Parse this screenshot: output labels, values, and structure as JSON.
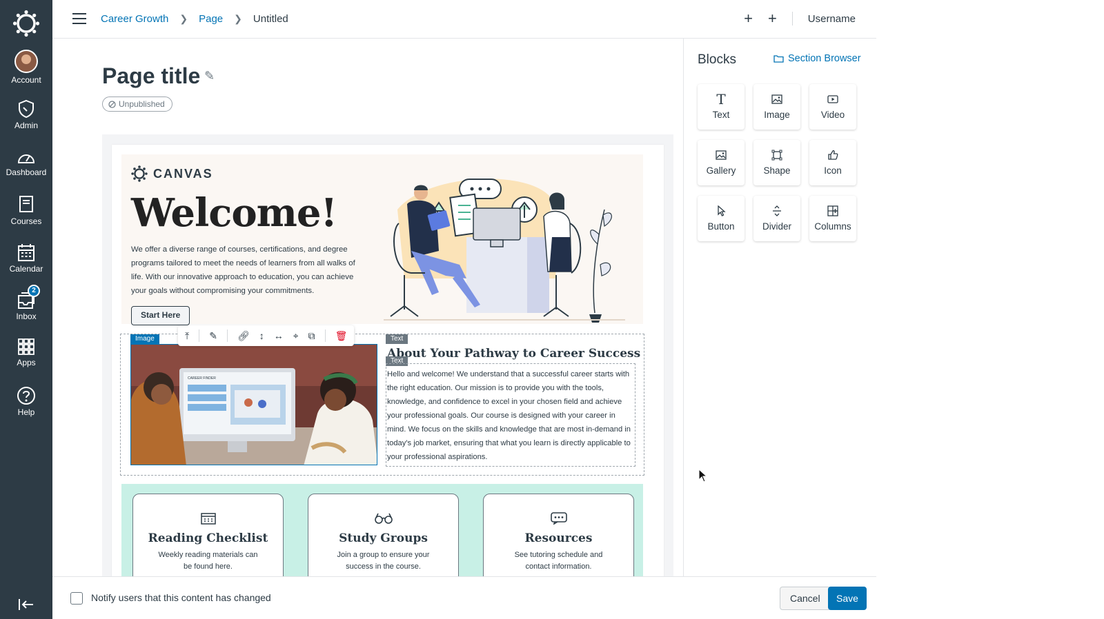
{
  "nav": {
    "items": [
      {
        "label": "Account"
      },
      {
        "label": "Admin"
      },
      {
        "label": "Dashboard"
      },
      {
        "label": "Courses"
      },
      {
        "label": "Calendar"
      },
      {
        "label": "Inbox",
        "badge": "2"
      },
      {
        "label": "Apps"
      },
      {
        "label": "Help"
      }
    ]
  },
  "topbar": {
    "breadcrumbs": [
      "Career Growth",
      "Page",
      "Untitled"
    ],
    "username": "Username"
  },
  "page": {
    "title": "Page title",
    "status": "Unpublished"
  },
  "hero": {
    "brand": "CANVAS",
    "heading": "Welcome!",
    "body": "We offer a diverse range of courses, certifications, and degree programs tailored to meet the needs of learners from all walks of life. With our innovative approach to education, you can achieve your goals without compromising your commitments.",
    "button": "Start Here"
  },
  "selection": {
    "image_tag": "Image",
    "text_tag": "Text",
    "text_tag2": "Text",
    "about_heading": "About Your Pathway to Career Success",
    "about_body": "Hello and welcome! We understand that a successful career starts with the right education. Our mission is to provide you with the tools, knowledge, and confidence to excel in your chosen field and achieve your professional goals. Our course is designed with your career in mind. We focus on the skills and knowledge that are most in-demand in today's job market, ensuring that what you learn is directly applicable to your professional aspirations.",
    "monitor_header": "CAREER FINDER"
  },
  "cards": [
    {
      "title": "Reading Checklist",
      "desc": "Weekly reading materials can be found here.",
      "icon": "calendar-grid-icon"
    },
    {
      "title": "Study Groups",
      "desc": "Join a group to ensure your success in the course.",
      "icon": "glasses-icon"
    },
    {
      "title": "Resources",
      "desc": "See tutoring schedule and contact information.",
      "icon": "chat-bubble-icon"
    }
  ],
  "footer": {
    "notify_label": "Notify users that this content has changed",
    "cancel": "Cancel",
    "save": "Save"
  },
  "blocks_panel": {
    "title": "Blocks",
    "section_browser": "Section Browser",
    "blocks": [
      {
        "label": "Text"
      },
      {
        "label": "Image"
      },
      {
        "label": "Video"
      },
      {
        "label": "Gallery"
      },
      {
        "label": "Shape"
      },
      {
        "label": "Icon"
      },
      {
        "label": "Button"
      },
      {
        "label": "Divider"
      },
      {
        "label": "Columns"
      }
    ]
  },
  "colors": {
    "nav_bg": "#2d3b45",
    "brand_blue": "#0374b5",
    "hero_bg": "#fbf7f3",
    "cards_bg": "#c8f0e6",
    "delete_red": "#e0061f"
  }
}
